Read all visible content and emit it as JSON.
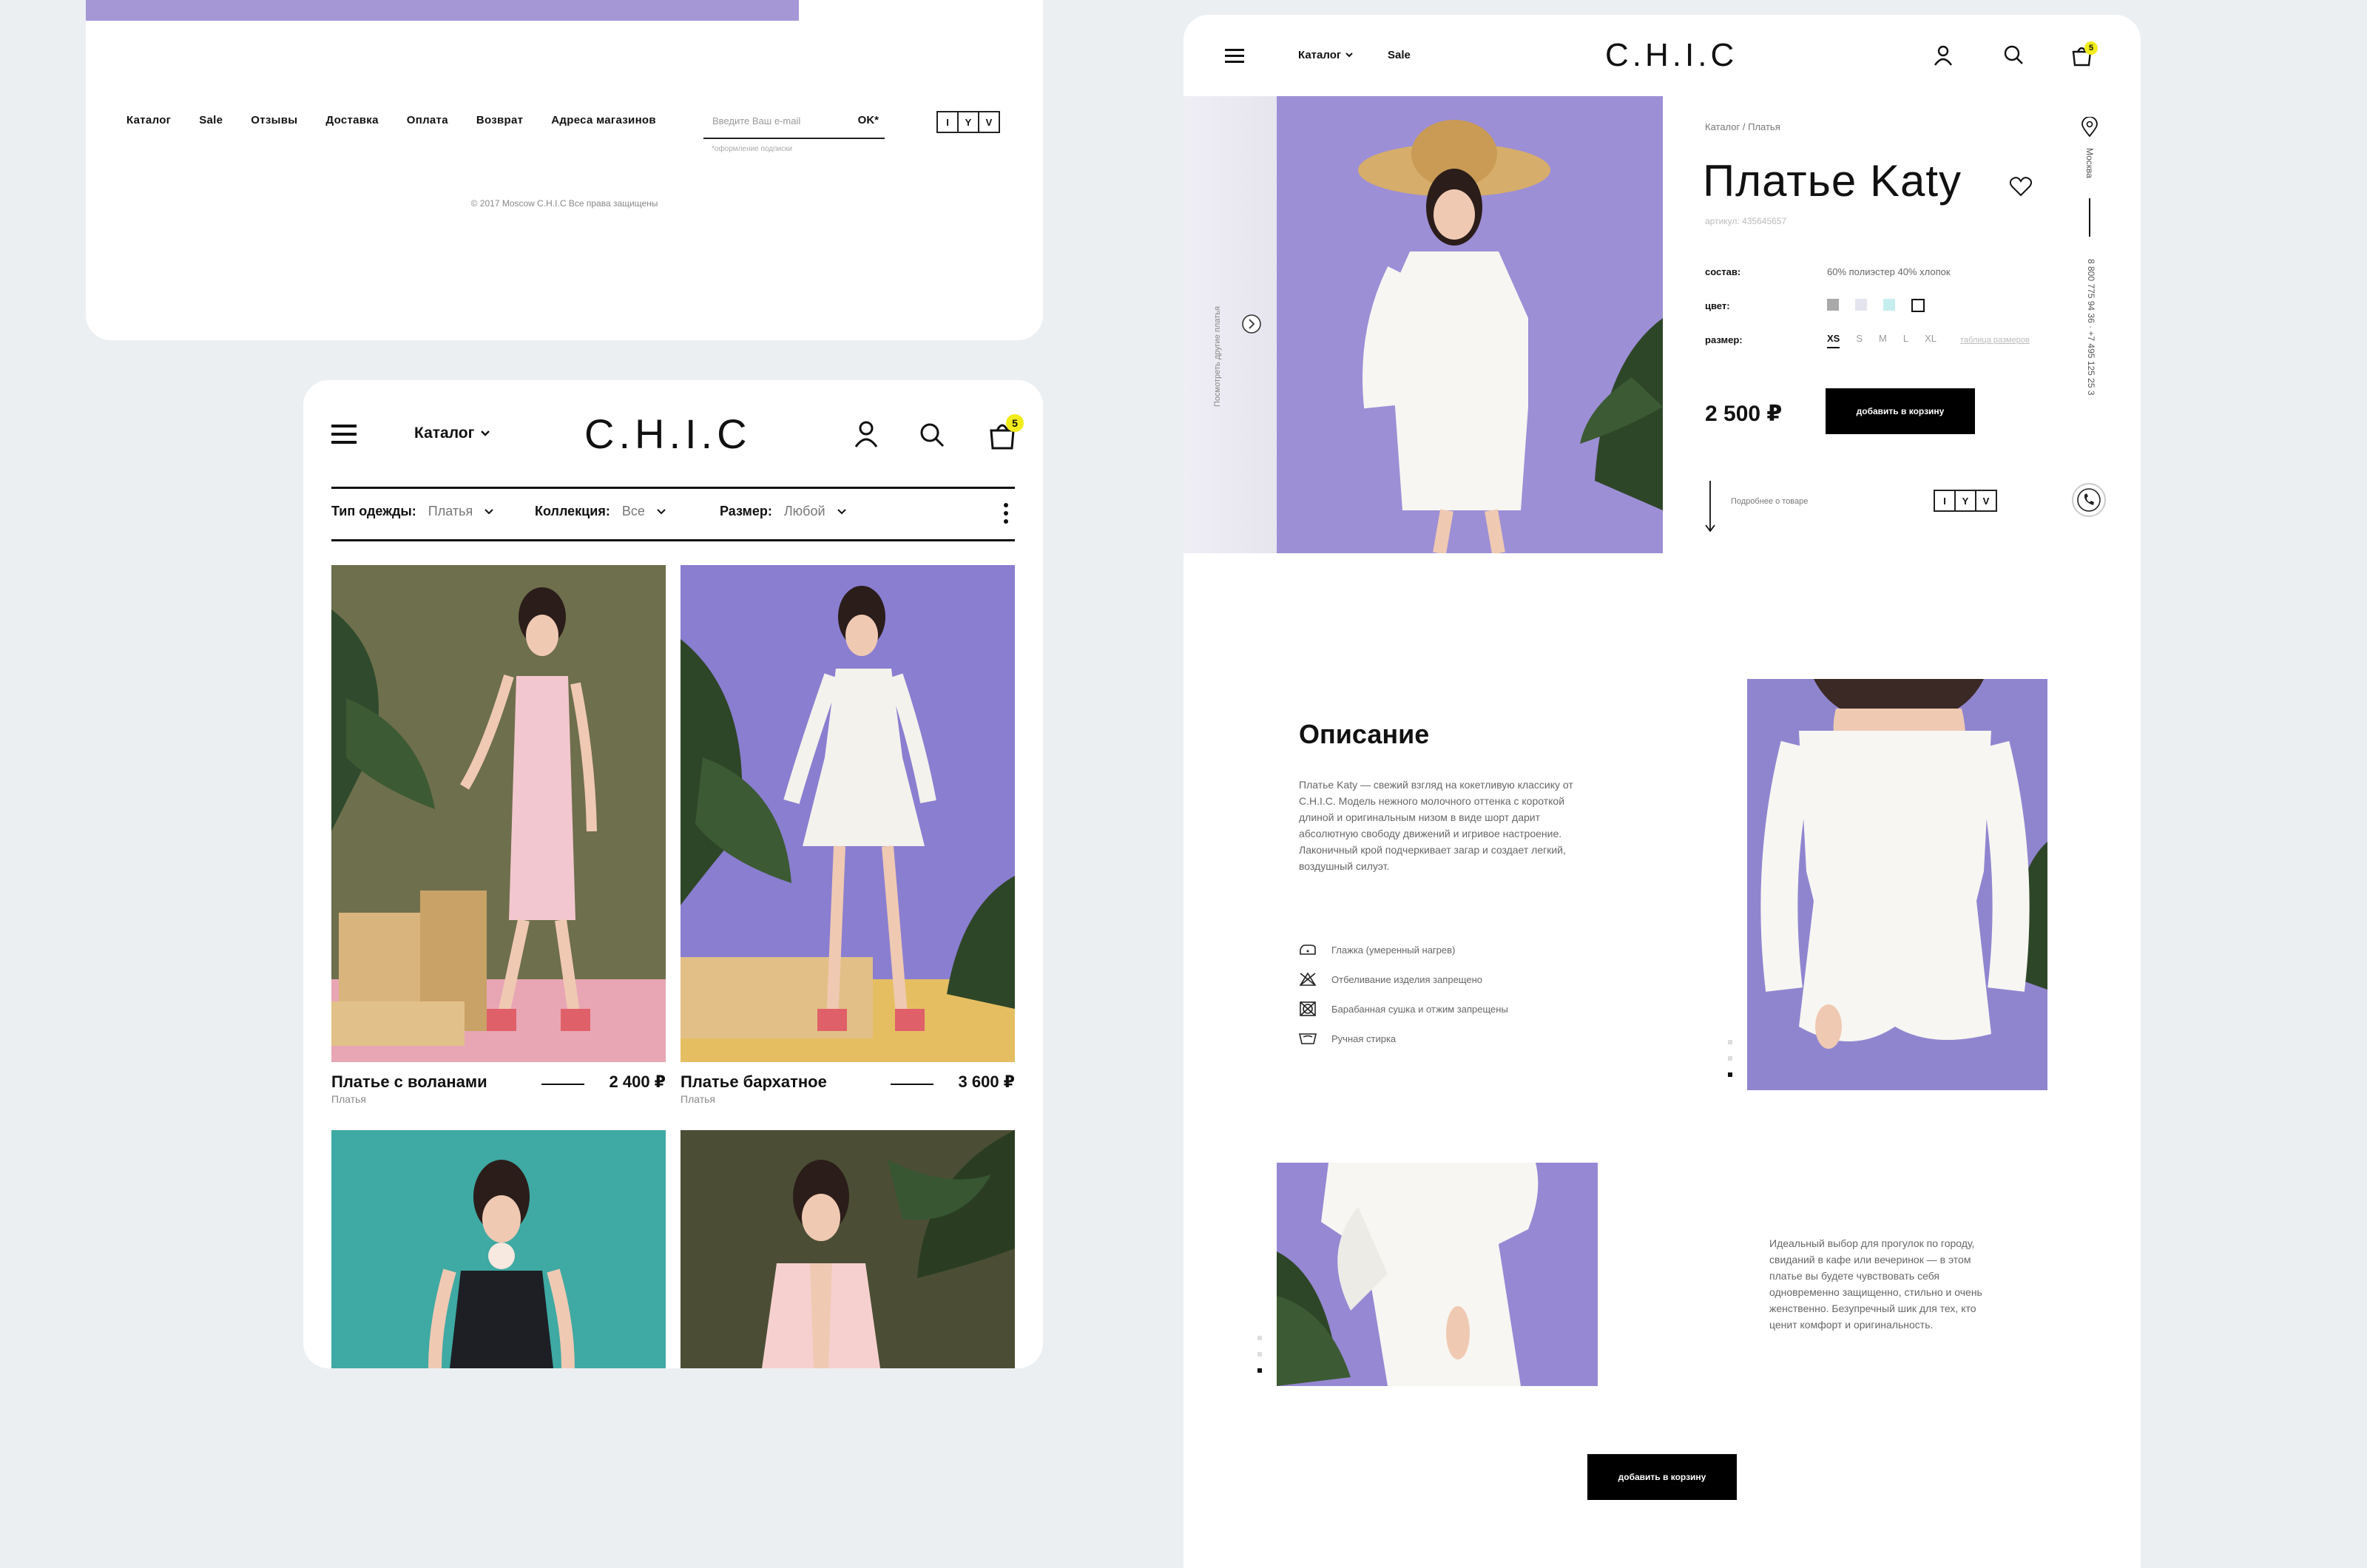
{
  "footer_card": {
    "nav": [
      "Каталог",
      "Sale",
      "Отзывы",
      "Доставка",
      "Оплата",
      "Возврат",
      "Адреса магазинов"
    ],
    "email_placeholder": "Введите Ваш e-mail",
    "ok_label": "OK*",
    "subscribe_note": "*оформление подписки",
    "copyright": "© 2017 Moscow C.H.I.C Все права защищены",
    "lang": [
      "I",
      "Y",
      "V"
    ]
  },
  "catalog_card": {
    "logo": "C.H.I.C",
    "catalog_label": "Каталог",
    "cart_count": "5",
    "filters": [
      {
        "label": "Тип одежды:",
        "value": "Платья"
      },
      {
        "label": "Коллекция:",
        "value": "Все"
      },
      {
        "label": "Размер:",
        "value": "Любой"
      }
    ],
    "products": [
      {
        "name": "Платье с воланами",
        "category": "Платья",
        "price": "2 400 ₽"
      },
      {
        "name": "Платье бархатное",
        "category": "Платья",
        "price": "3 600 ₽"
      }
    ]
  },
  "product_card": {
    "nav_catalog": "Каталог",
    "nav_sale": "Sale",
    "logo": "C.H.I.C",
    "cart_count": "5",
    "side_caption": "Посмотреть другие платья",
    "breadcrumb": "Каталог / Платья",
    "title": "Платье Katy",
    "article": "артикул: 435645657",
    "composition_label": "состав:",
    "composition_value": "60% полиэстер 40% хлопок",
    "color_label": "цвет:",
    "colors": [
      "#a9a9a9",
      "#e3e4ee",
      "#c6eeee",
      "#ffffff"
    ],
    "size_label": "размер:",
    "sizes": [
      "XS",
      "S",
      "M",
      "L",
      "XL"
    ],
    "size_table_link": "таблица размеров",
    "price": "2 500 ₽",
    "add_to_cart": "добавить в корзину",
    "more_info": "Подробнее о товаре",
    "lang": [
      "I",
      "Y",
      "V"
    ],
    "city": "Москва",
    "phones": "8 800 775 94 36 · +7 495 125 25 3",
    "description_title": "Описание",
    "description_text": "Платье Katy — свежий взгляд на кокетливую классику от C.H.I.C. Модель нежного молочного оттенка с короткой длиной и оригинальным низом в виде шорт дарит абсолютную свободу движений и игривое настроение. Лаконичный крой подчеркивает загар и создает легкий, воздушный силуэт.",
    "care": [
      {
        "icon": "iron-icon",
        "text": "Глажка (умеренный нагрев)"
      },
      {
        "icon": "no-bleach-icon",
        "text": "Отбеливание изделия запрещено"
      },
      {
        "icon": "no-tumble-dry-icon",
        "text": "Барабанная сушка и отжим запрещены"
      },
      {
        "icon": "hand-wash-icon",
        "text": "Ручная стирка"
      }
    ],
    "lower_text": "Идеальный выбор для прогулок по городу, свиданий в кафе или вечеринок — в этом платье вы будете чувствовать себя одновременно защищенно, стильно и очень женственно. Безупречный шик для тех, кто ценит комфорт и оригинальность.",
    "bottom_cta": "добавить в корзину"
  },
  "colors": {
    "accent_purple": "#a597d6",
    "badge_yellow": "#f2ec1a"
  }
}
